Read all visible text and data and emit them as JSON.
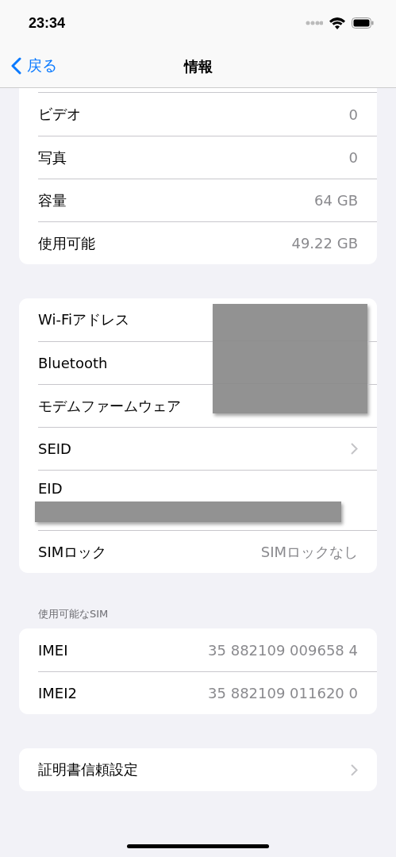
{
  "status_bar": {
    "time": "23:34"
  },
  "nav": {
    "back": "戻る",
    "title": "情報"
  },
  "groups": [
    {
      "clipped_top": true,
      "rows": [
        {
          "kind": "value",
          "label": "ビデオ",
          "value": "0"
        },
        {
          "kind": "value",
          "label": "写真",
          "value": "0"
        },
        {
          "kind": "value",
          "label": "容量",
          "value": "64 GB"
        },
        {
          "kind": "value",
          "label": "使用可能",
          "value": "49.22 GB"
        }
      ]
    },
    {
      "rows": [
        {
          "kind": "redacted",
          "label": "Wi-Fiアドレス"
        },
        {
          "kind": "redacted",
          "label": "Bluetooth"
        },
        {
          "kind": "redacted",
          "label": "モデムファームウェア"
        },
        {
          "kind": "chevron",
          "label": "SEID"
        },
        {
          "kind": "stacked",
          "label": "EID"
        },
        {
          "kind": "value",
          "label": "SIMロック",
          "value": "SIMロックなし"
        }
      ]
    },
    {
      "header": "使用可能なSIM",
      "rows": [
        {
          "kind": "value",
          "label": "IMEI",
          "value": "35 882109 009658 4"
        },
        {
          "kind": "value",
          "label": "IMEI2",
          "value": "35 882109 011620 0"
        }
      ]
    },
    {
      "rows": [
        {
          "kind": "chevron",
          "label": "証明書信頼設定"
        }
      ]
    }
  ]
}
